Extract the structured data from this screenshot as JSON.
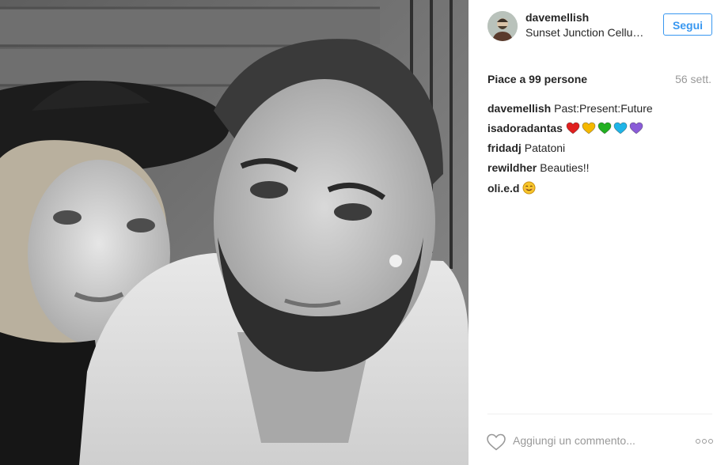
{
  "post": {
    "username": "davemellish",
    "location": "Sunset Junction Cellu…",
    "follow_label": "Segui",
    "likes": "Piace a 99 persone",
    "time_ago": "56 sett.",
    "comments": [
      {
        "author": "davemellish",
        "text": "Past:Present:Future"
      },
      {
        "author": "isadoradantas",
        "text": "",
        "emoji_hearts": [
          "#e0201f",
          "#f5b800",
          "#22b020",
          "#1fb5e8",
          "#8a5cd8"
        ]
      },
      {
        "author": "fridadj",
        "text": "Patatoni"
      },
      {
        "author": "rewildher",
        "text": "Beauties!!"
      },
      {
        "author": "oli.e.d",
        "text": "",
        "emoji": "smiling-face-icon"
      }
    ],
    "comment_placeholder": "Aggiungi un commento...",
    "icons": {
      "like": "heart-outline-icon",
      "more": "more-options-icon"
    },
    "colors": {
      "accent": "#3897f0",
      "muted": "#999999",
      "text": "#262626"
    }
  }
}
